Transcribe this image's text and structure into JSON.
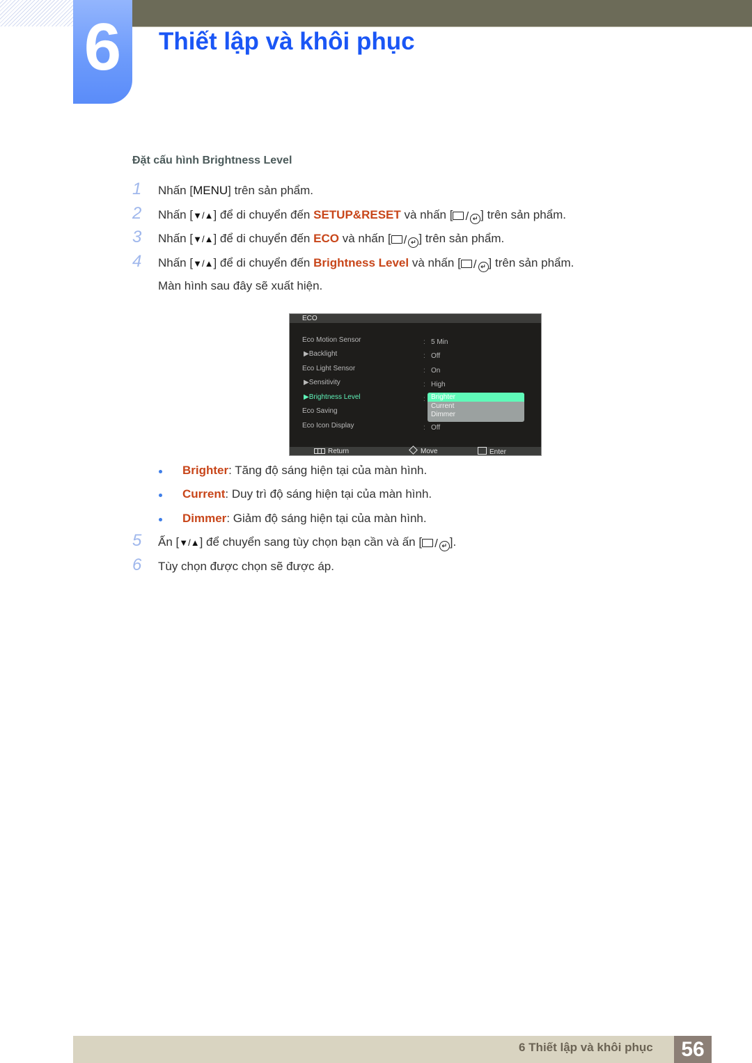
{
  "chapter": {
    "number": "6",
    "title": "Thiết lập và khôi phục"
  },
  "section_title": "Đặt cấu hình Brightness Level",
  "steps": [
    {
      "num": "1",
      "pre": "Nhấn [",
      "key": "MENU",
      "post": "] trên sản phẩm."
    },
    {
      "num": "2",
      "pre": "Nhấn [",
      "arrows": "▼/▲",
      "mid": "] để di chuyển đến ",
      "target": "SETUP&RESET",
      "mid2": " và nhấn [",
      "post": "] trên sản phẩm."
    },
    {
      "num": "3",
      "pre": "Nhấn [",
      "arrows": "▼/▲",
      "mid": "] để di chuyển đến ",
      "target": "ECO",
      "mid2": " và nhấn [",
      "post": "] trên sản phẩm."
    },
    {
      "num": "4",
      "pre": "Nhấn [",
      "arrows": "▼/▲",
      "mid": "] để di chuyển đến ",
      "target": "Brightness Level",
      "mid2": " và nhấn [",
      "post": "] trên sản phẩm."
    },
    {
      "num": "5",
      "pre": "Ấn [",
      "arrows": "▼/▲",
      "mid": "] để chuyển sang tùy chọn bạn cần và ấn [",
      "post": "]."
    },
    {
      "num": "6",
      "text": "Tùy chọn được chọn sẽ được áp."
    }
  ],
  "step4_followup": "Màn hình sau đây sẽ xuất hiện.",
  "osd": {
    "header": "ECO",
    "items": [
      {
        "label": "Eco Motion Sensor",
        "value": "5 Min"
      },
      {
        "label": "Backlight",
        "value": "Off",
        "sub": true
      },
      {
        "label": "Eco Light Sensor",
        "value": "On"
      },
      {
        "label": "Sensitivity",
        "value": "High",
        "sub": true
      },
      {
        "label": "Brightness Level",
        "value": "",
        "sub": true,
        "active": true
      },
      {
        "label": "Eco Saving",
        "value": ""
      },
      {
        "label": "Eco Icon Display",
        "value": "Off"
      }
    ],
    "dropdown": {
      "options": [
        "Brighter",
        "Current",
        "Dimmer"
      ],
      "selected": "Brighter"
    },
    "footer": {
      "return": "Return",
      "move": "Move",
      "enter": "Enter"
    },
    "colors": {
      "active": "#5ff2b8",
      "background": "#1e1d1b"
    }
  },
  "options": [
    {
      "name": "Brighter",
      "desc": ": Tăng độ sáng hiện tại của màn hình."
    },
    {
      "name": "Current",
      "desc": ": Duy trì độ sáng hiện tại của màn hình."
    },
    {
      "name": "Dimmer",
      "desc": ": Giảm độ sáng hiện tại của màn hình."
    }
  ],
  "footer": {
    "label": "6 Thiết lập và khôi phục",
    "page": "56"
  },
  "colors": {
    "highlight": "#c8461a",
    "title": "#1a56f5",
    "chapter_tab": "#6d9bfb",
    "topbar": "#6c6b58"
  }
}
